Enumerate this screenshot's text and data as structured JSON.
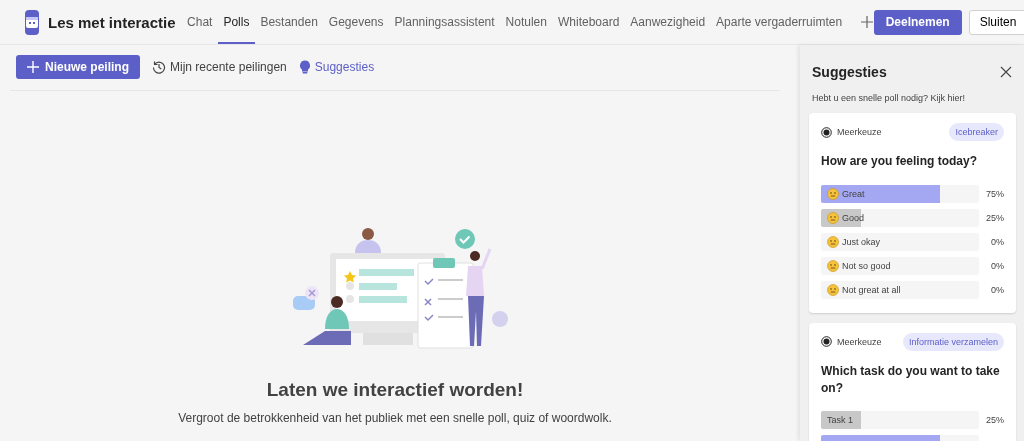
{
  "header": {
    "title": "Les met interactie",
    "tabs": [
      {
        "label": "Chat",
        "selected": false
      },
      {
        "label": "Polls",
        "selected": true
      },
      {
        "label": "Bestanden",
        "selected": false
      },
      {
        "label": "Gegevens",
        "selected": false
      },
      {
        "label": "Planningsassistent",
        "selected": false
      },
      {
        "label": "Notulen",
        "selected": false
      },
      {
        "label": "Whiteboard",
        "selected": false
      },
      {
        "label": "Aanwezigheid",
        "selected": false
      },
      {
        "label": "Aparte vergaderruimten",
        "selected": false
      }
    ],
    "buttons": [
      "Deelnemen",
      "Sluiten"
    ]
  },
  "toolbar": {
    "new_poll": "Nieuwe peiling",
    "recent": "Mijn recente peilingen",
    "suggestions": "Suggesties"
  },
  "empty_state": {
    "heading": "Laten we interactief worden!",
    "text": "Vergroot de betrokkenheid van het publiek met een snelle poll, quiz of woordwolk."
  },
  "panel": {
    "title": "Suggesties",
    "subtitle": "Hebt u een snelle poll nodig? Kijk hier!",
    "cards": [
      {
        "type": "Meerkeuze",
        "tag": "Icebreaker",
        "question": "How are you feeling today?",
        "options": [
          {
            "kind": "emoji",
            "label": "Great",
            "level": 0.75,
            "color": "#a4a8f2",
            "reading": "75%"
          },
          {
            "kind": "emoji",
            "label": "Good",
            "level": 0.25,
            "color": "#c8c8c8",
            "reading": "25%"
          },
          {
            "kind": "emoji",
            "label": "Just okay",
            "reading": "0%"
          },
          {
            "kind": "emoji",
            "label": "Not so good",
            "reading": "0%"
          },
          {
            "kind": "emoji",
            "label": "Not great at all",
            "reading": "0%"
          }
        ]
      },
      {
        "type": "Meerkeuze",
        "tag": "Informatie verzamelen",
        "question": "Which task do you want to take on?",
        "options": [
          {
            "kind": "text",
            "label": "Task 1",
            "level": 0.25,
            "color": "#c8c8c8",
            "reading": "25%"
          },
          {
            "kind": "text",
            "level": 0.75,
            "color": "#a4a8f2"
          }
        ]
      }
    ]
  }
}
